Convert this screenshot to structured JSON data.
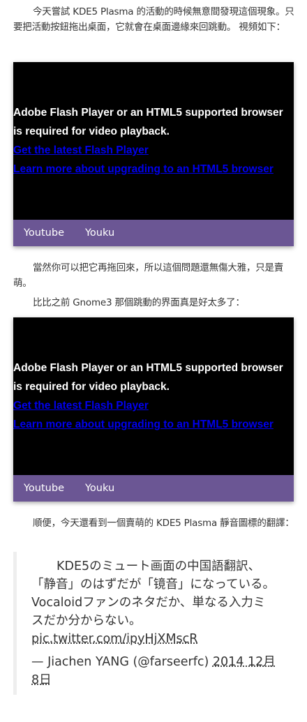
{
  "paragraphs": [
    "今天嘗試 KDE5 Plasma 的活動的時候無意間發現這個現象。只要把活動按鈕拖出桌面，它就會在桌面邊緣來回跳動。 視頻如下：",
    "當然你可以把它再拖回來，所以這個問題還無傷大雅，只是賣萌。",
    "比比之前 Gnome3 那個跳動的界面真是好太多了：",
    "順便，今天還看到一個賣萌的 KDE5 Plasma 靜音圖標的翻譯："
  ],
  "video": {
    "message": "Adobe Flash Player or an HTML5 supported browser is required for video playback.",
    "link_flash": "Get the latest Flash Player ",
    "link_html5": "Learn more about upgrading to an HTML5 browser",
    "tabs": [
      "Youtube",
      "Youku"
    ]
  },
  "tweet": {
    "text": "KDE5のミュート画面の中国語翻訳、「静音」のはずだが「镜音」になっている。Vocaloidファンのネタだか、単なる入力ミスだか分からない。",
    "link": "pic.twitter.com/ipyHjXMscR",
    "author": "— Jiachen YANG (@farseerfc) ",
    "date": "2014 12月 8日"
  }
}
